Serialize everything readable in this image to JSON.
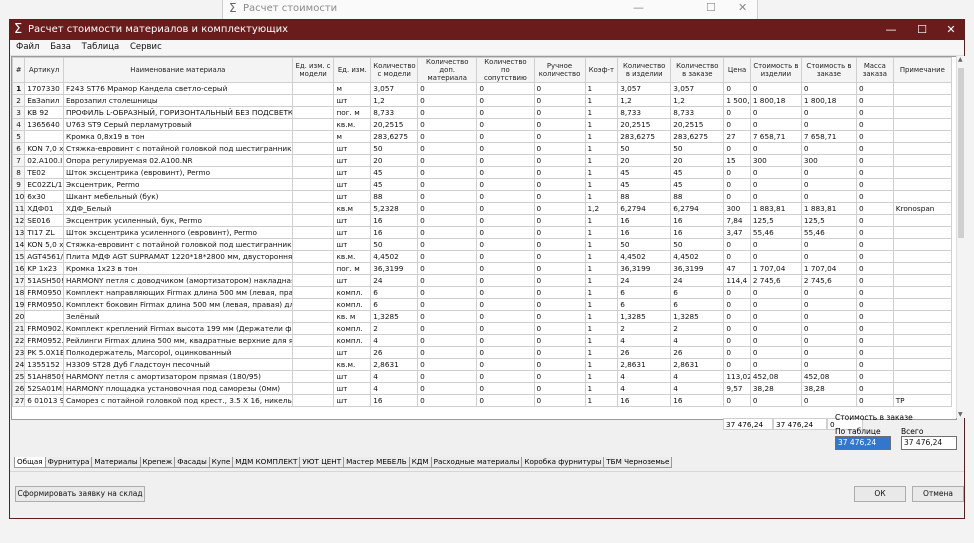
{
  "background_window": {
    "title": "Расчет стоимости"
  },
  "window": {
    "title": "Расчет стоимости материалов и комплектующих"
  },
  "menu": [
    "Файл",
    "База",
    "Таблица",
    "Сервис"
  ],
  "columns": [
    "#",
    "Артикул",
    "Наименование материала",
    "Ед. изм. с модели",
    "Ед. изм.",
    "Количество с модели",
    "Количество доп. материала",
    "Количество по сопутствию",
    "Ручное количество",
    "Коэф-т",
    "Количество в изделии",
    "Количество в заказе",
    "Цена",
    "Стоимость в изделии",
    "Стоимость в заказе",
    "Масса заказа",
    "Примечание"
  ],
  "rows": [
    [
      "1",
      "1707330",
      "F243 ST76 Мрамор Кандела светло-серый",
      "",
      "м",
      "3,057",
      "0",
      "0",
      "0",
      "1",
      "3,057",
      "3,057",
      "0",
      "0",
      "0",
      "0",
      ""
    ],
    [
      "2",
      "ЕвЗапил",
      "Еврозапил столешницы",
      "",
      "шт",
      "1,2",
      "0",
      "0",
      "0",
      "1",
      "1,2",
      "1,2",
      "1 500,1",
      "1 800,18",
      "1 800,18",
      "0",
      ""
    ],
    [
      "3",
      "KB 92",
      "ПРОФИЛЬ L-ОБРАЗНЫЙ, ГОРИЗОНТАЛЬНЫЙ БЕЗ ПОДСВЕТКИ КВ 9",
      "",
      "пог. м",
      "8,733",
      "0",
      "0",
      "0",
      "1",
      "8,733",
      "8,733",
      "0",
      "0",
      "0",
      "0",
      ""
    ],
    [
      "4",
      "1365640",
      "U763 ST9 Серый перламутровый",
      "",
      "кв.м.",
      "20,2515",
      "0",
      "0",
      "0",
      "1",
      "20,2515",
      "20,2515",
      "0",
      "0",
      "0",
      "0",
      ""
    ],
    [
      "5",
      "",
      "Кромка 0,8х19 в тон",
      "",
      "м",
      "283,6275",
      "0",
      "0",
      "0",
      "1",
      "283,6275",
      "283,6275",
      "27",
      "7 658,71",
      "7 658,71",
      "0",
      ""
    ],
    [
      "6",
      "KON 7,0 x",
      "Стяжка-евровинт с потайной головкой под шестигранник, желт",
      "",
      "шт",
      "50",
      "0",
      "0",
      "0",
      "1",
      "50",
      "50",
      "0",
      "0",
      "0",
      "0",
      ""
    ],
    [
      "7",
      "02.A100.I",
      "Опора регулируемая 02.A100.NR",
      "",
      "шт",
      "20",
      "0",
      "0",
      "0",
      "1",
      "20",
      "20",
      "15",
      "300",
      "300",
      "0",
      ""
    ],
    [
      "8",
      "TE02",
      "Шток эксцентрика (евровинт), Permo",
      "",
      "шт",
      "45",
      "0",
      "0",
      "0",
      "1",
      "45",
      "45",
      "0",
      "0",
      "0",
      "0",
      ""
    ],
    [
      "9",
      "EC02ZL/1",
      "Эксцентрик, Permo",
      "",
      "шт",
      "45",
      "0",
      "0",
      "0",
      "1",
      "45",
      "45",
      "0",
      "0",
      "0",
      "0",
      ""
    ],
    [
      "10",
      "6x30",
      "Шкант мебельный (бук)",
      "",
      "шт",
      "88",
      "0",
      "0",
      "0",
      "1",
      "88",
      "88",
      "0",
      "0",
      "0",
      "0",
      ""
    ],
    [
      "11",
      "ХДФ01",
      "ХДФ_Белый",
      "",
      "кв.м",
      "5,2328",
      "0",
      "0",
      "0",
      "1,2",
      "6,2794",
      "6,2794",
      "300",
      "1 883,81",
      "1 883,81",
      "0",
      "Kronospan"
    ],
    [
      "12",
      "SE016",
      "Эксцентрик усиленный, бук, Permo",
      "",
      "шт",
      "16",
      "0",
      "0",
      "0",
      "1",
      "16",
      "16",
      "7,84",
      "125,5",
      "125,5",
      "0",
      ""
    ],
    [
      "13",
      "TI17 ZL",
      "Шток эксцентрика усиленного (евровинт), Permo",
      "",
      "шт",
      "16",
      "0",
      "0",
      "0",
      "1",
      "16",
      "16",
      "3,47",
      "55,46",
      "55,46",
      "0",
      ""
    ],
    [
      "14",
      "KON 5,0 x",
      "Стяжка-евровинт с потайной головкой под шестигранник, оцин",
      "",
      "шт",
      "50",
      "0",
      "0",
      "0",
      "1",
      "50",
      "50",
      "0",
      "0",
      "0",
      "0",
      ""
    ],
    [
      "15",
      "AGT4561/",
      "Плита МДФ AGT SUPRAMAT 1220*18*2800 мм, двусторонняя, суп",
      "",
      "кв.м.",
      "4,4502",
      "0",
      "0",
      "0",
      "1",
      "4,4502",
      "4,4502",
      "0",
      "0",
      "0",
      "0",
      ""
    ],
    [
      "16",
      "KP 1x23",
      "Кромка 1х23 в тон",
      "",
      "пог. м",
      "36,3199",
      "0",
      "0",
      "0",
      "1",
      "36,3199",
      "36,3199",
      "47",
      "1 707,04",
      "1 707,04",
      "0",
      ""
    ],
    [
      "17",
      "51ASH50!",
      "HARMONY петля с доводчиком (амортизатором) накладная (90/1",
      "",
      "шт",
      "24",
      "0",
      "0",
      "0",
      "1",
      "24",
      "24",
      "114,4",
      "2 745,6",
      "2 745,6",
      "0",
      ""
    ],
    [
      "18",
      "FRM0950",
      "Комплект направляющих Firmax длина 500 мм (левая, правая) д.",
      "",
      "компл.",
      "6",
      "0",
      "0",
      "0",
      "1",
      "6",
      "6",
      "0",
      "0",
      "0",
      "0",
      ""
    ],
    [
      "19",
      "FRM0950.",
      "Комплект боковин Firmax длина 500 мм (левая, правая) для ящик",
      "",
      "компл.",
      "6",
      "0",
      "0",
      "0",
      "1",
      "6",
      "6",
      "0",
      "0",
      "0",
      "0",
      ""
    ],
    [
      "20",
      "",
      "Зелёный",
      "",
      "кв. м",
      "1,3285",
      "0",
      "0",
      "0",
      "1",
      "1,3285",
      "1,3285",
      "0",
      "0",
      "0",
      "0",
      ""
    ],
    [
      "21",
      "FRM0902.",
      "Комплект креплений Firmax высота 199 мм (Держатели фасада,",
      "",
      "компл.",
      "2",
      "0",
      "0",
      "0",
      "1",
      "2",
      "2",
      "0",
      "0",
      "0",
      "0",
      ""
    ],
    [
      "22",
      "FRM0952.",
      "Рейлинги Firmax длина 500 мм, квадратные верхние для ящика I",
      "",
      "компл.",
      "4",
      "0",
      "0",
      "0",
      "1",
      "4",
      "4",
      "0",
      "0",
      "0",
      "0",
      ""
    ],
    [
      "23",
      "PK 5.0X1E",
      "Полкодержатель, Marcopol, оцинкованный",
      "",
      "шт",
      "26",
      "0",
      "0",
      "0",
      "1",
      "26",
      "26",
      "0",
      "0",
      "0",
      "0",
      ""
    ],
    [
      "24",
      "1355152",
      "H3309 ST28 Дуб Гладстоун песочный",
      "",
      "кв.м.",
      "2,8631",
      "0",
      "0",
      "0",
      "1",
      "2,8631",
      "2,8631",
      "0",
      "0",
      "0",
      "0",
      ""
    ],
    [
      "25",
      "51AH850!",
      "HARMONY петля с амортизатором прямая (180/95)",
      "",
      "шт",
      "4",
      "0",
      "0",
      "0",
      "1",
      "4",
      "4",
      "113,02",
      "452,08",
      "452,08",
      "0",
      ""
    ],
    [
      "26",
      "52SA01M:",
      "HARMONY площадка установочная под саморезы (0мм)",
      "",
      "шт",
      "4",
      "0",
      "0",
      "0",
      "1",
      "4",
      "4",
      "9,57",
      "38,28",
      "38,28",
      "0",
      ""
    ],
    [
      "27",
      "6 01013 9",
      "Саморез с потайной головкой под крест., 3.5 X 16, никель",
      "",
      "шт",
      "16",
      "0",
      "0",
      "0",
      "1",
      "16",
      "16",
      "0",
      "0",
      "0",
      "0",
      "ТР"
    ]
  ],
  "totals": {
    "izd": "37 476,24",
    "zak": "37 476,24",
    "mass": "0"
  },
  "cost": {
    "header": "Стоимость в заказе",
    "by_table_label": "По таблице",
    "total_label": "Всего",
    "by_table_value": "37 476,24",
    "total_value": "37 476,24"
  },
  "tabs": [
    "Общая",
    "Фурнитура",
    "Материалы",
    "Крепеж",
    "Фасады",
    "Купе",
    "МДМ КОМПЛЕКТ",
    "УЮТ ЦЕНТ",
    "Мастер МЕБЕЛЬ",
    "КДМ",
    "Расходные материалы",
    "Коробка фурнитуры",
    "ТБМ Черноземье"
  ],
  "buttons": {
    "order": "Сформировать заявку на склад",
    "ok": "ОК",
    "cancel": "Отмена"
  }
}
